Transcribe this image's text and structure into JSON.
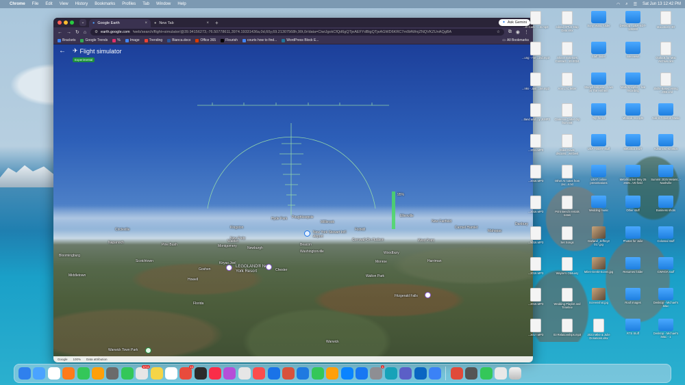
{
  "menubar": {
    "app": "Chrome",
    "items": [
      "File",
      "Edit",
      "View",
      "History",
      "Bookmarks",
      "Profiles",
      "Tab",
      "Window",
      "Help"
    ],
    "clock": "Sat Jun 13 12:42 PM"
  },
  "browser": {
    "tabs": [
      {
        "title": "Google Earth",
        "active": true
      },
      {
        "title": "New Tab",
        "active": false
      }
    ],
    "ask_gemini": "Ask Gemini",
    "url_host": "earth.google.com",
    "url_path": "/web/search/flight+simulator/@39.94156273,-76.50778611,3974.19331436a,0d,60y,69.21307568h,90t,0r/data=CiwiJgokCfQd6gQTjeAEFYdBigQTjeAGWD6KRC7m0tAWnjZNQVKZUnAQgBA",
    "bookmarks": [
      "Brackets",
      "Google Trends",
      "%",
      "Image",
      "Trending",
      "Bianca.docx",
      "Office 365",
      "Flourish",
      "courts how to find...",
      "WordPress Block E..."
    ],
    "all_bookmarks": "All Bookmarks"
  },
  "earth": {
    "title": "Flight simulator",
    "badge": "Experimental",
    "hud_speed_pct": "95%",
    "places": [
      "Hyde Park",
      "Poughkeepsie",
      "Millbrook",
      "Kingston",
      "New Paltz",
      "Napanoch",
      "Pine Bush",
      "Walden",
      "Montgomery",
      "Newburgh",
      "Beacon",
      "Cornwall-On-Hudson",
      "Fishkill",
      "New York Stewart Int'l Airport",
      "Washingtonville",
      "Woodbury",
      "West Point",
      "Circleville",
      "Bloomingburg",
      "Middletown",
      "Scotchtown",
      "Kiryas Joel",
      "Goshen",
      "LEGOLAND® New York Resort",
      "Chester",
      "Monroe",
      "Harriman",
      "Walton Park",
      "Fitzgerald Falls",
      "Florida",
      "Warwick Town Park",
      "Warwick",
      "Howell",
      "Carmel Hamlet",
      "Mahopac",
      "New Fairfield",
      "Danbury",
      "Ellenville"
    ],
    "footer": [
      "Google",
      "100%",
      "Data attribution"
    ]
  },
  "desktop_icons": [
    {
      "label": "...m Cars - ...m.mp3",
      "kind": "doc"
    },
    {
      "label": "edited GPLS Map Data.xlsx",
      "kind": "doc"
    },
    {
      "label": "Sony Music folder",
      "kind": "folder"
    },
    {
      "label": "Desktop - USA-EDT-136360",
      "kind": "folder"
    },
    {
      "label": "Macintosh HD",
      "kind": "doc"
    },
    {
      "label": "...ung - I've ...ind.mp3",
      "kind": "doc"
    },
    {
      "label": "Shiner Exteriors Contract...10-2024",
      "kind": "doc"
    },
    {
      "label": "Staff folder",
      "kind": "folder"
    },
    {
      "label": "interviews",
      "kind": "folder"
    },
    {
      "label": "Outlook for Mac Archive.olm",
      "kind": "doc"
    },
    {
      "label": "...nks - Just ...ne.mp3",
      "kind": "doc"
    },
    {
      "label": "Ann LTC letter",
      "kind": "doc"
    },
    {
      "label": "Sturgill Simpson - Live at The Anthem",
      "kind": "folder"
    },
    {
      "label": "Mark Knopfler - live recording",
      "kind": "folder"
    },
    {
      "label": "Skills-Based Hiring -...OBI.xml",
      "kind": "doc"
    },
    {
      "label": "...tland and ...y Jr.MP3",
      "kind": "doc"
    },
    {
      "label": "Clarence Carter clip from BB",
      "kind": "doc"
    },
    {
      "label": "Top forms",
      "kind": "folder"
    },
    {
      "label": "Medical receipts",
      "kind": "folder"
    },
    {
      "label": "Add to Amazon Music",
      "kind": "folder"
    },
    {
      "label": "...2011.MP3",
      "kind": "doc"
    },
    {
      "label": "Miles Davis discussi...wmbest",
      "kind": "doc"
    },
    {
      "label": "USA TODAY stuff",
      "kind": "folder"
    },
    {
      "label": "Metallica 2027",
      "kind": "folder"
    },
    {
      "label": "Advanced Kinetics",
      "kind": "folder"
    },
    {
      "label": "...2016.MP3",
      "kind": "doc"
    },
    {
      "label": "Other AI notes from Jac...s.txt",
      "kind": "doc"
    },
    {
      "label": "USAT online presentations",
      "kind": "folder"
    },
    {
      "label": "Metallica live May 25 2025...VD field",
      "kind": "folder"
    },
    {
      "label": "Summit 2025 MetaM...-Nashville",
      "kind": "folder"
    },
    {
      "label": "...2016.MP3",
      "kind": "doc"
    },
    {
      "label": "Print Bench rentals notes",
      "kind": "doc"
    },
    {
      "label": "Wedding music",
      "kind": "folder"
    },
    {
      "label": "Other stuff",
      "kind": "folder"
    },
    {
      "label": "Business shots",
      "kind": "folder"
    },
    {
      "label": "...5016.MP3",
      "kind": "doc"
    },
    {
      "label": "Set Songs",
      "kind": "doc"
    },
    {
      "label": "Garland_Jeffrey2 017.jpg",
      "kind": "img"
    },
    {
      "label": "Photos for Julie",
      "kind": "folder"
    },
    {
      "label": "Colossal stuff",
      "kind": "folder"
    },
    {
      "label": "...2016.MP3",
      "kind": "doc"
    },
    {
      "label": "Wayne's Obituary",
      "kind": "doc"
    },
    {
      "label": "Miles-Genkt-Sceen.jpg",
      "kind": "img"
    },
    {
      "label": "Resumes folder",
      "kind": "folder"
    },
    {
      "label": "CWHOA stuff",
      "kind": "folder"
    },
    {
      "label": "...2016.MP3",
      "kind": "doc"
    },
    {
      "label": "Wedding Playlist and Timeline",
      "kind": "doc"
    },
    {
      "label": "Screenshot.jpg",
      "kind": "img"
    },
    {
      "label": "Roof images",
      "kind": "folder"
    },
    {
      "label": "Desktop - Michael's iMac",
      "kind": "folder"
    },
    {
      "label": "...2017.MP3",
      "kind": "doc"
    },
    {
      "label": "03 Relationships.mp3",
      "kind": "doc"
    },
    {
      "label": "2023 Mike & Julie Donations.xlsx",
      "kind": "doc"
    },
    {
      "label": "RTS Stuff",
      "kind": "folder"
    },
    {
      "label": "Desktop - Michael's iMac - 1",
      "kind": "folder"
    }
  ],
  "dock": {
    "badges": {
      "mail": "6714",
      "calendar": "13",
      "settings": "1"
    },
    "app_colors": [
      "#2f80ed",
      "#4aa3ff",
      "#ffffff",
      "#ff7a1a",
      "#34c759",
      "#ff9f0a",
      "#6b6b6b",
      "#34c759",
      "#e6e6e6",
      "#f5d547",
      "#ffffff",
      "#e84b3c",
      "#2b2b2b",
      "#fa2d48",
      "#b54fd8",
      "#e6e6e6",
      "#fa4d4d",
      "#1a73e8",
      "#d8523b",
      "#1f7ae0",
      "#34c759",
      "#ff9f0a",
      "#0a84ff",
      "#1877f2",
      "#8e8e93",
      "#17a2b8",
      "#5b5fc7",
      "#0a66c2",
      "#3b82f6",
      "#e04a3a",
      "#555555",
      "#34c759",
      "#e8e8e8"
    ]
  }
}
